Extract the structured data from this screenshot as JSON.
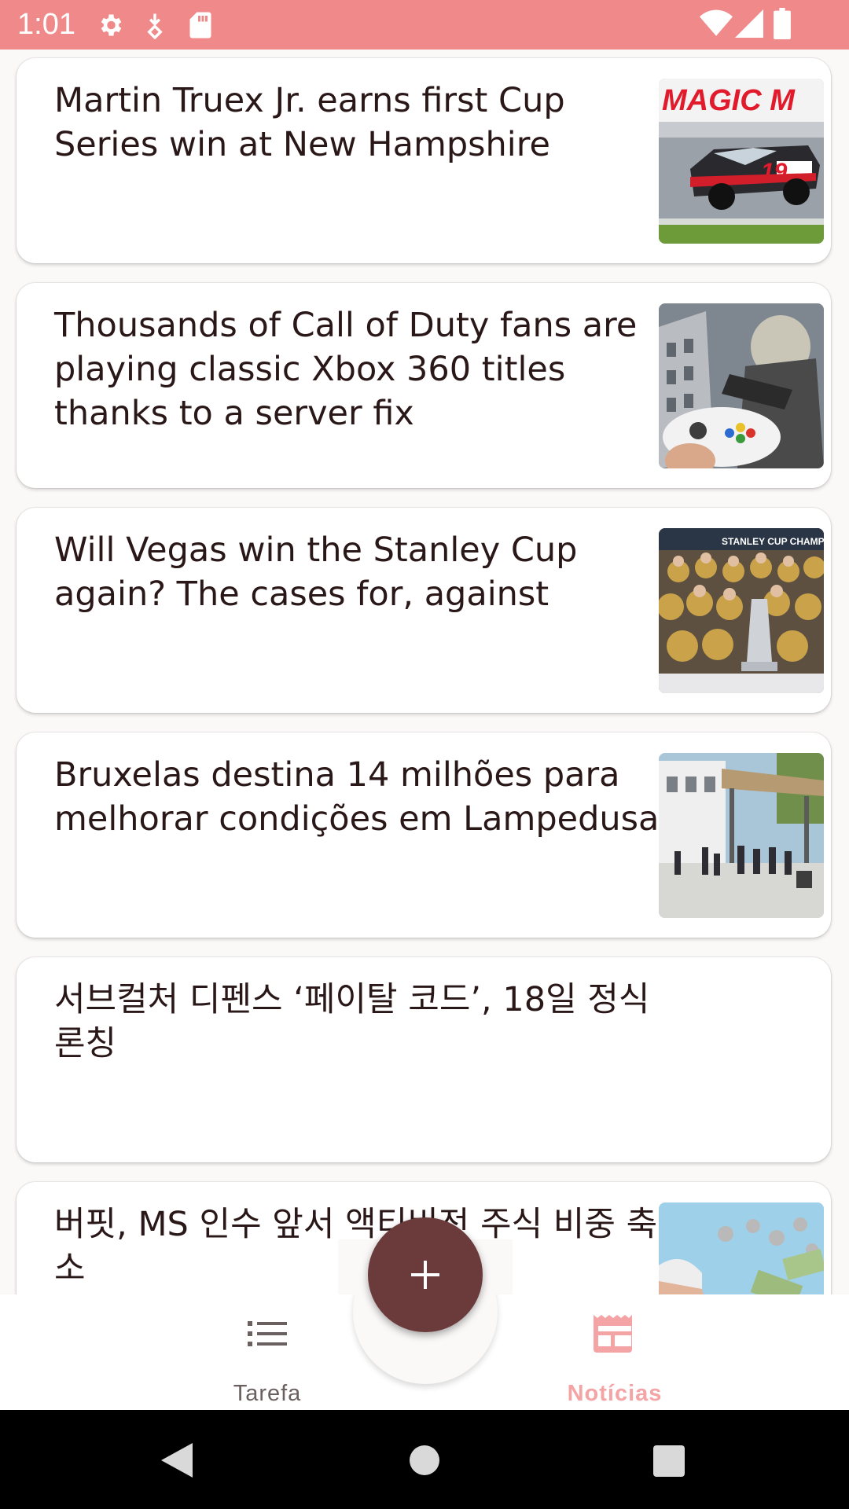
{
  "status_bar": {
    "time": "1:01",
    "icons": [
      "settings-icon",
      "download-icon",
      "sd-card-icon",
      "wifi-icon",
      "signal-icon",
      "battery-icon"
    ],
    "background": "#f08a8a"
  },
  "news": [
    {
      "title": "Martin Truex Jr. earns first Cup Series win at New Hampshire",
      "has_image": true,
      "image": "nascar-race-car-photo",
      "image_text": "MAGIC M"
    },
    {
      "title": "Thousands of Call of Duty fans are playing classic Xbox 360 titles thanks to a server fix",
      "has_image": true,
      "image": "call-of-duty-soldier-controller-photo"
    },
    {
      "title": "Will Vegas win the Stanley Cup again? The cases for, against",
      "has_image": true,
      "image": "stanley-cup-celebration-photo",
      "image_text": "STANLEY CUP CHAMPION"
    },
    {
      "title": "Bruxelas destina 14 milhões para melhorar condições em Lampedusa",
      "has_image": true,
      "image": "lampedusa-shelter-photo"
    },
    {
      "title": "서브컬처 디펜스 ‘페이탈 코드’, 18일 정식 론칭",
      "has_image": false
    },
    {
      "title": "버핏, MS 인수 앞서 액티비전 주식 비중 축소",
      "has_image": true,
      "image": "warren-buffett-money-photo"
    }
  ],
  "fab": {
    "icon": "plus-icon",
    "color": "#6b3a3a"
  },
  "bottom_nav": {
    "items": [
      {
        "label": "Tarefa",
        "icon": "list-icon",
        "selected": false,
        "color": "#6b6060"
      },
      {
        "label": "Notícias",
        "icon": "newspaper-icon",
        "selected": true,
        "color": "#f4a4a4"
      }
    ]
  },
  "system_nav": {
    "buttons": [
      "back-button",
      "home-button",
      "recents-button"
    ]
  }
}
